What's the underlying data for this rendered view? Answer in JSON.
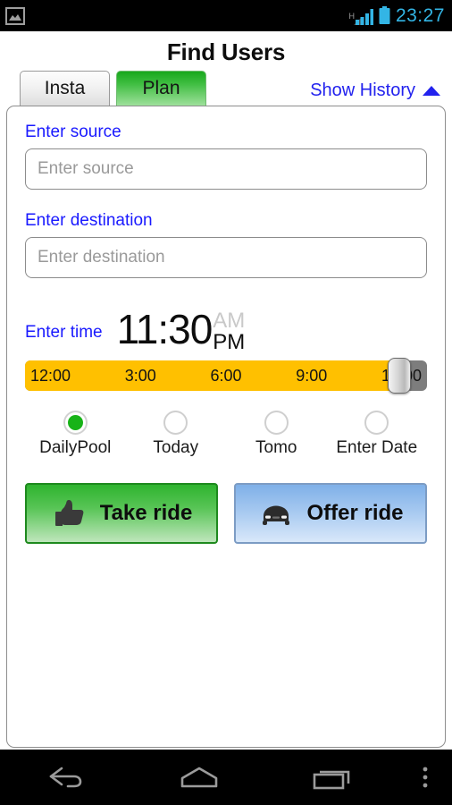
{
  "statusbar": {
    "notification_icon": "gallery-image-icon",
    "network_type": "H",
    "signal_icon": "signal-bars-icon",
    "battery_icon": "battery-full-icon",
    "time": "23:27",
    "time_color": "#33b5e5"
  },
  "header": {
    "title": "Find Users"
  },
  "tabs": [
    {
      "label": "Insta",
      "active": false
    },
    {
      "label": "Plan",
      "active": true
    }
  ],
  "history_link": {
    "label": "Show History",
    "icon": "caret-up-icon",
    "color": "#2222ee"
  },
  "form": {
    "source": {
      "label": "Enter source",
      "placeholder": "Enter source",
      "value": ""
    },
    "destination": {
      "label": "Enter destination",
      "placeholder": "Enter destination",
      "value": ""
    },
    "time": {
      "label": "Enter time",
      "digits": "11:30",
      "am_label": "AM",
      "pm_label": "PM",
      "selected_meridiem": "PM"
    }
  },
  "slider": {
    "ticks": [
      "12:00",
      "3:00",
      "6:00",
      "9:00",
      "12:00"
    ],
    "track_color": "#ffc000",
    "fill_percent": 93,
    "thumb_percent": 93
  },
  "radios": [
    {
      "label": "DailyPool",
      "selected": true
    },
    {
      "label": "Today",
      "selected": false
    },
    {
      "label": "Tomo",
      "selected": false
    },
    {
      "label": "Enter Date",
      "selected": false
    }
  ],
  "actions": [
    {
      "label": "Take ride",
      "icon": "thumbs-up-icon",
      "color": "#2fb42f"
    },
    {
      "label": "Offer ride",
      "icon": "car-front-icon",
      "color": "#7fb0e8"
    }
  ],
  "navbar": [
    {
      "name": "back",
      "icon": "back-arrow-icon"
    },
    {
      "name": "home",
      "icon": "home-icon"
    },
    {
      "name": "recents",
      "icon": "recents-icon"
    },
    {
      "name": "overflow",
      "icon": "overflow-menu-icon"
    }
  ]
}
